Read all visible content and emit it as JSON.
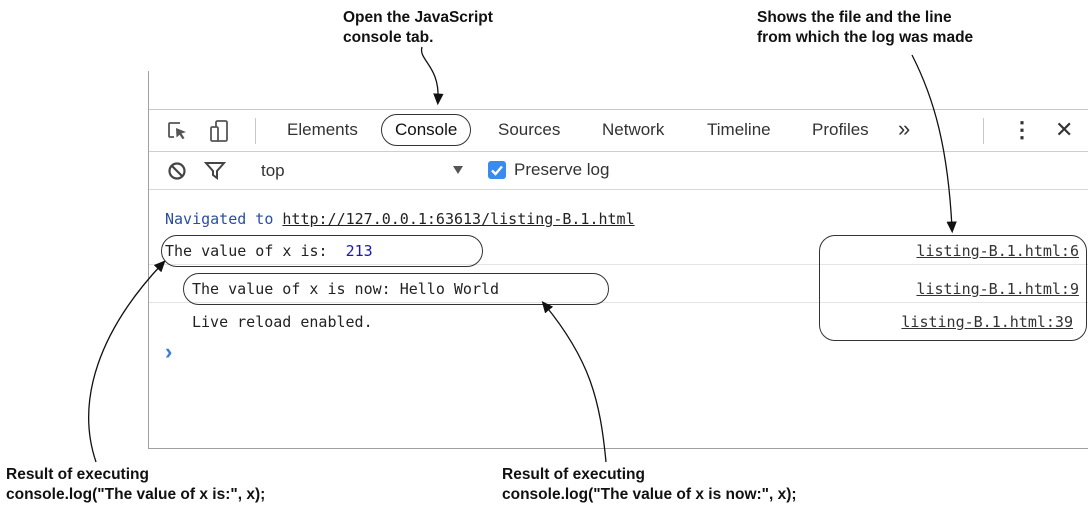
{
  "annotations": {
    "top_center": "Open the JavaScript\nconsole tab.",
    "top_right": "Shows the file and the line\nfrom which the log was made",
    "bottom_left": "Result of executing\nconsole.log(\"The value of x is:\", x);",
    "bottom_center": "Result of executing\nconsole.log(\"The value of x is now:\", x);"
  },
  "toolbar": {
    "tabs": [
      "Elements",
      "Console",
      "Sources",
      "Network",
      "Timeline",
      "Profiles"
    ],
    "active_tab": "Console",
    "overflow": "»",
    "menu": "⋮",
    "close": "✕"
  },
  "filter": {
    "context": "top",
    "preserve_log_label": "Preserve log",
    "preserve_log_checked": true
  },
  "console": {
    "nav_prefix": "Navigated to ",
    "nav_url": "http://127.0.0.1:63613/listing-B.1.html",
    "rows": [
      {
        "text": "The value of x is:  ",
        "value": "213",
        "source": "listing-B.1.html:6"
      },
      {
        "text": "The value of x is now: Hello World",
        "source": "listing-B.1.html:9"
      },
      {
        "text": "Live reload enabled.",
        "source": "listing-B.1.html:39"
      }
    ],
    "prompt": "›"
  },
  "colors": {
    "nav_text": "#2a4fa0",
    "value": "#1a1aa6",
    "prompt": "#3b7dd8",
    "checkbox": "#3b8af0"
  }
}
